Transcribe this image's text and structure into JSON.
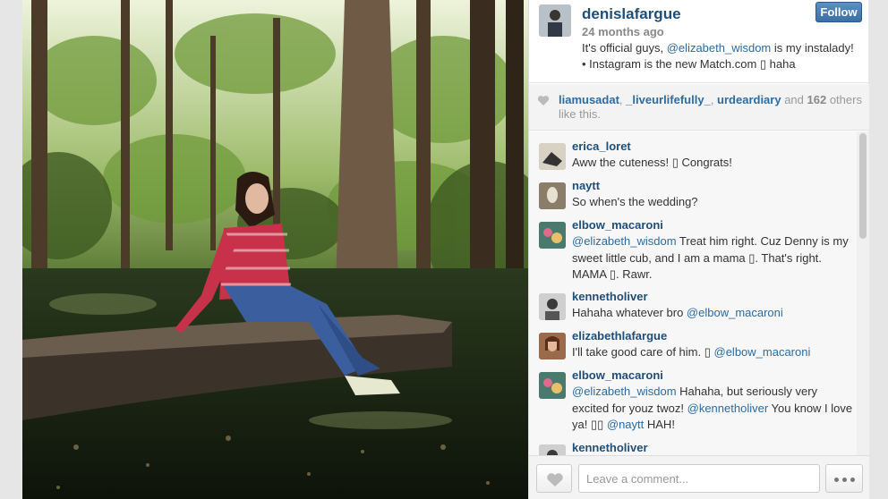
{
  "post": {
    "owner": "denislafargue",
    "time": "24 months ago",
    "follow_label": "Follow",
    "caption_pre": "It's official guys, ",
    "caption_mention": "@elizabeth_wisdom",
    "caption_post": " is my instalady! • Instagram is the new Match.com ▯ haha"
  },
  "likes": {
    "user1": "liamusadat",
    "sep1": ", ",
    "user2": "_liveurlifefully_",
    "sep2": ", ",
    "user3": "urdeardiary",
    "and": " and ",
    "count": "162",
    "rest": " others like this."
  },
  "comments": [
    {
      "user": "erica_loret",
      "mention": "",
      "text": "Aww the cuteness! ▯ Congrats!",
      "mention_after": ""
    },
    {
      "user": "naytt",
      "mention": "",
      "text": "So when's the wedding?",
      "mention_after": ""
    },
    {
      "user": "elbow_macaroni",
      "mention": "@elizabeth_wisdom",
      "text": " Treat him right. Cuz Denny is my sweet little cub, and I am a mama ▯. That's right. MAMA ▯. Rawr.",
      "mention_after": ""
    },
    {
      "user": "kennetholiver",
      "mention": "",
      "text": "Hahaha whatever bro ",
      "mention_after": "@elbow_macaroni"
    },
    {
      "user": "elizabethlafargue",
      "mention": "",
      "text": "I'll take good care of him. ▯ ",
      "mention_after": "@elbow_macaroni"
    },
    {
      "user": "elbow_macaroni",
      "mention": "@elizabeth_wisdom",
      "text": " Hahaha, but seriously very excited for youz twoz! ",
      "mention_after": "@kennetholiver",
      "text2": " You know I love ya! ▯▯ ",
      "mention2": "@naytt",
      "text3": " HAH!"
    },
    {
      "user": "kennetholiver",
      "mention": "",
      "text": "",
      "mention_after": ""
    }
  ],
  "footer": {
    "comment_placeholder": "Leave a comment..."
  },
  "icons": {
    "heart": "heart-icon",
    "more": "more-dots-icon"
  },
  "colors": {
    "username": "#1f4e79",
    "mention": "#2c6ca3",
    "follow_button": "#3c6fa5"
  }
}
